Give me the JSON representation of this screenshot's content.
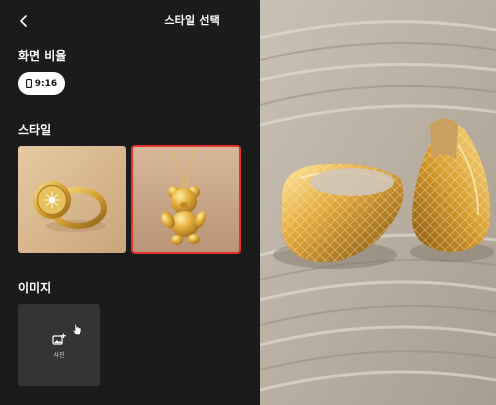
{
  "header": {
    "title": "스타일 선택",
    "back_icon": "chevron-left-icon"
  },
  "aspect_ratio": {
    "label": "화면 비율",
    "selected": "9:16",
    "icon": "phone-icon"
  },
  "style": {
    "label": "스타일",
    "items": [
      {
        "name": "gold-ring-style",
        "selected": false
      },
      {
        "name": "bear-pendant-style",
        "selected": true
      }
    ]
  },
  "image": {
    "label": "이미지",
    "upload_label": "사진",
    "upload_icon": "add-photo-icon"
  },
  "colors": {
    "panel_bg": "#1b1b1b",
    "card_bg": "#343434",
    "selected_border": "#e2332f",
    "gold": "#d8a535"
  }
}
